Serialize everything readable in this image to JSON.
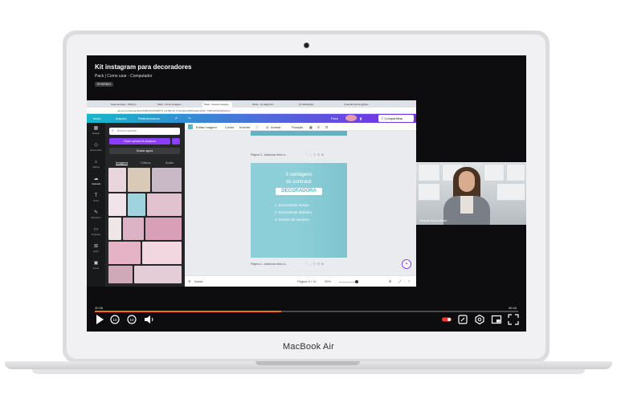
{
  "device": {
    "brand_label": "MacBook Air"
  },
  "video": {
    "title": "Kit instagram para decoradores",
    "subtitle": "Pack | Como usar - Computador",
    "badge": "EPISÓDIO"
  },
  "browser": {
    "tabs": [
      "Guia de faces - WhS pt...",
      "Pack - Kit de Instagra...",
      "Pack - Pacote Instagra...",
      "Mode - by diagr bol...",
      "(1) WhatsApp",
      "Amanda Souza (@sou..."
    ],
    "url": "canva.com/design/DAFSuBc9Jr9/LRM8Y6_G1J6j1V8_KnSwukSoFWNmEHxxSd1 / FMKN1K6k7k0kZ/ed..."
  },
  "canva": {
    "topbar": {
      "home": "Início",
      "file": "Arquivo",
      "resize": "Redimensionar",
      "present": "Pack",
      "share": "Compartilhar"
    },
    "sidebar": [
      {
        "icon": "design-icon",
        "glyph": "▦",
        "label": "Design"
      },
      {
        "icon": "elements-icon",
        "glyph": "◇",
        "label": "Elementos"
      },
      {
        "icon": "brand-icon",
        "glyph": "⌂",
        "label": "Marca"
      },
      {
        "icon": "uploads-icon",
        "glyph": "☁",
        "label": "Uploads"
      },
      {
        "icon": "text-icon",
        "glyph": "T",
        "label": "Texto"
      },
      {
        "icon": "draw-icon",
        "glyph": "✎",
        "label": "Desenho"
      },
      {
        "icon": "projects-icon",
        "glyph": "▭",
        "label": "Projetos"
      },
      {
        "icon": "apps-icon",
        "glyph": "⊞",
        "label": "Apps"
      },
      {
        "icon": "photos-icon",
        "glyph": "▣",
        "label": "Fotos"
      }
    ],
    "panel": {
      "search_placeholder": "Buscar uploads",
      "upload_button": "Fazer upload de arquivos",
      "record_button": "Gravar agora",
      "tabs": [
        "Imagens",
        "Vídeos",
        "Áudio"
      ]
    },
    "toolbar": {
      "edit_image": "Editar imagem",
      "crop": "Cortar",
      "flip": "Inverter",
      "animate": "Animar",
      "position": "Posição"
    },
    "editor": {
      "page3_label": "Página 3 - Adicionar título à...",
      "page4_label": "Página 4 - Adicionar título à...",
      "slide": {
        "line1": "3 vantagens",
        "line2": "de contratar",
        "highlight": "DECORADORA",
        "items": [
          "1. Economizar tempo",
          "2. Economizar dinheiro",
          "3. Evento de sucesso"
        ]
      }
    },
    "statusbar": {
      "notes": "Notas",
      "page": "Página 3 / 10",
      "zoom": "39%"
    }
  },
  "webcam": {
    "name": "Amanda Souza Bauer"
  },
  "player": {
    "current_time": "40:36",
    "duration": "56:46",
    "progress": 0.44,
    "colors": {
      "accent": "#ff6a1a"
    }
  }
}
